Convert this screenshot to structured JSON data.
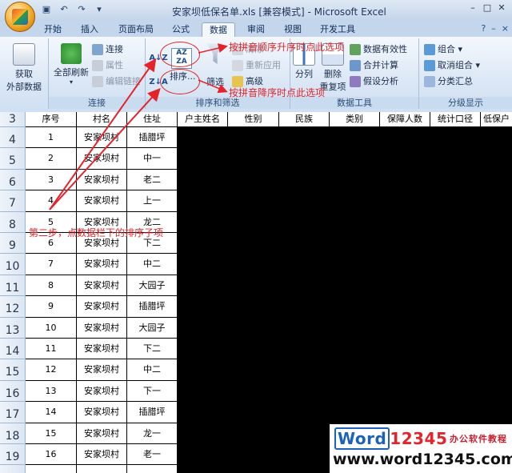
{
  "window": {
    "title": "安家坝低保名单.xls [兼容模式] - Microsoft Excel",
    "controls": [
      "–",
      "□",
      "✕"
    ]
  },
  "quick_access": [
    "save-icon",
    "undo-icon",
    "redo-icon",
    "customize-icon"
  ],
  "tabs": [
    "开始",
    "插入",
    "页面布局",
    "公式",
    "数据",
    "审阅",
    "视图",
    "开发工具"
  ],
  "active_tab": "数据",
  "ribbon": {
    "get_external": {
      "line1": "获取",
      "line2": "外部数据"
    },
    "connections": {
      "refresh_all": "全部刷新",
      "connections": "连接",
      "properties": "属性",
      "edit_links": "编辑链接",
      "label": "连接"
    },
    "sort_filter": {
      "sort_asc": "A↓Z",
      "sort_desc": "Z↓A",
      "sort": "排序...",
      "filter": "筛选",
      "clear": "清除",
      "reapply": "重新应用",
      "advanced": "高级",
      "label": "排序和筛选"
    },
    "data_tools": {
      "text_to_columns": "分列",
      "remove_dup_1": "删除",
      "remove_dup_2": "重复项",
      "validation": "数据有效性",
      "consolidate": "合并计算",
      "what_if": "假设分析",
      "label": "数据工具"
    },
    "outline": {
      "group": "组合",
      "ungroup": "取消组合",
      "subtotal": "分类汇总",
      "label": "分级显示"
    }
  },
  "sheet": {
    "header_row_number": "3",
    "headers": [
      "序号",
      "村名",
      "住址",
      "户主姓名",
      "性别",
      "民族",
      "类别",
      "保障人数",
      "统计口径",
      "低保户"
    ],
    "rows": [
      {
        "num": "4",
        "seq": "1",
        "village": "安家坝村",
        "addr": "插腊坪"
      },
      {
        "num": "5",
        "seq": "2",
        "village": "安家坝村",
        "addr": "中一"
      },
      {
        "num": "6",
        "seq": "3",
        "village": "安家坝村",
        "addr": "老二"
      },
      {
        "num": "7",
        "seq": "4",
        "village": "安家坝村",
        "addr": "上一"
      },
      {
        "num": "8",
        "seq": "5",
        "village": "安家坝村",
        "addr": "龙二"
      },
      {
        "num": "9",
        "seq": "6",
        "village": "安家坝村",
        "addr": "下二"
      },
      {
        "num": "10",
        "seq": "7",
        "village": "安家坝村",
        "addr": "中二"
      },
      {
        "num": "11",
        "seq": "8",
        "village": "安家坝村",
        "addr": "大园子"
      },
      {
        "num": "12",
        "seq": "9",
        "village": "安家坝村",
        "addr": "插腊坪"
      },
      {
        "num": "13",
        "seq": "10",
        "village": "安家坝村",
        "addr": "大园子"
      },
      {
        "num": "14",
        "seq": "11",
        "village": "安家坝村",
        "addr": "下二"
      },
      {
        "num": "15",
        "seq": "12",
        "village": "安家坝村",
        "addr": "中二"
      },
      {
        "num": "16",
        "seq": "13",
        "village": "安家坝村",
        "addr": "下一"
      },
      {
        "num": "17",
        "seq": "14",
        "village": "安家坝村",
        "addr": "插腊坪"
      },
      {
        "num": "18",
        "seq": "15",
        "village": "安家坝村",
        "addr": "龙一"
      },
      {
        "num": "19",
        "seq": "16",
        "village": "安家坝村",
        "addr": "老一"
      }
    ]
  },
  "annotations": {
    "asc_note": "按拼音顺序升序时点此选项",
    "desc_note": "按拼音降序时点此选项",
    "step_note": "第二步，点数据栏下的排序子项"
  },
  "watermark": {
    "brand_word": "Word",
    "brand_num": "12345",
    "brand_cn": "办公软件教程",
    "url": "www.word12345.com"
  }
}
